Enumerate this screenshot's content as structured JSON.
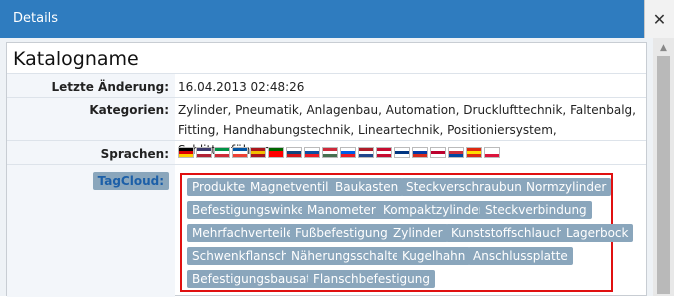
{
  "window": {
    "title": "Details",
    "close_glyph": "✕"
  },
  "panel": {
    "title": "Katalogname"
  },
  "rows": {
    "last_change": {
      "label": "Letzte Änderung:",
      "value": "16.04.2013 02:48:26"
    },
    "categories": {
      "label": "Kategorien:",
      "value": "Zylinder, Pneumatik, Anlagenbau, Automation, Drucklufttechnik, Faltenbalg, Fitting, Handhabungstechnik, Lineartechnik, Positioniersystem, Schlittenführung"
    },
    "languages": {
      "label": "Sprachen:"
    },
    "tagcloud": {
      "label": "TagCloud:"
    }
  },
  "flags": [
    {
      "name": "flag-de-icon",
      "colors": [
        "#000000",
        "#dd0000",
        "#ffce00"
      ]
    },
    {
      "name": "flag-us-icon",
      "colors": [
        "#3c3b6e",
        "#ffffff",
        "#b22234"
      ]
    },
    {
      "name": "flag-it-icon",
      "colors": [
        "#009246",
        "#ffffff",
        "#ce2b37"
      ]
    },
    {
      "name": "flag-fr-icon",
      "colors": [
        "#0055a4",
        "#ffffff",
        "#ef4135"
      ]
    },
    {
      "name": "flag-es-icon",
      "colors": [
        "#aa151b",
        "#f1bf00",
        "#aa151b"
      ]
    },
    {
      "name": "flag-pt-icon",
      "colors": [
        "#006600",
        "#ff0000",
        "#ff0000"
      ]
    },
    {
      "name": "flag-cz-icon",
      "colors": [
        "#ffffff",
        "#11457e",
        "#d7141a"
      ]
    },
    {
      "name": "flag-sk-icon",
      "colors": [
        "#ffffff",
        "#0b4ea2",
        "#ee1c25"
      ]
    },
    {
      "name": "flag-hu-icon",
      "colors": [
        "#ce2939",
        "#ffffff",
        "#477050"
      ]
    },
    {
      "name": "flag-si-icon",
      "colors": [
        "#ffffff",
        "#005ce5",
        "#ed1c24"
      ]
    },
    {
      "name": "flag-nl-icon",
      "colors": [
        "#ae1c28",
        "#ffffff",
        "#21468b"
      ]
    },
    {
      "name": "flag-dk-icon",
      "colors": [
        "#c60c30",
        "#ffffff",
        "#c60c30"
      ]
    },
    {
      "name": "flag-fi-icon",
      "colors": [
        "#ffffff",
        "#003580",
        "#ffffff"
      ]
    },
    {
      "name": "flag-ru-icon",
      "colors": [
        "#ffffff",
        "#0039a6",
        "#d52b1e"
      ]
    },
    {
      "name": "flag-jp-icon",
      "colors": [
        "#ffffff",
        "#bc002d",
        "#ffffff"
      ]
    },
    {
      "name": "flag-kr-icon",
      "colors": [
        "#ffffff",
        "#cd2e3a",
        "#0047a0"
      ]
    },
    {
      "name": "flag-cn-icon",
      "colors": [
        "#de2910",
        "#ffde00",
        "#de2910"
      ]
    },
    {
      "name": "flag-pl-icon",
      "colors": [
        "#ffffff",
        "#ffffff",
        "#dc143c"
      ]
    }
  ],
  "tags": [
    "Produkte",
    "Magnetventil",
    "Baukasten",
    "Steckverschraubung",
    "Normzylinder",
    "Befestigungswinkel",
    "Manometer",
    "Kompaktzylinder",
    "Steckverbindung",
    "Mehrfachverteiler",
    "Fußbefestigung",
    "Zylinder",
    "Kunststoffschlauch",
    "Lagerbock",
    "Schwenkflansch",
    "Näherungsschalter",
    "Kugelhahn",
    "Anschlussplatte",
    "Befestigungsbausatz",
    "Flanschbefestigung"
  ],
  "scroll": {
    "up_glyph": "▲"
  }
}
